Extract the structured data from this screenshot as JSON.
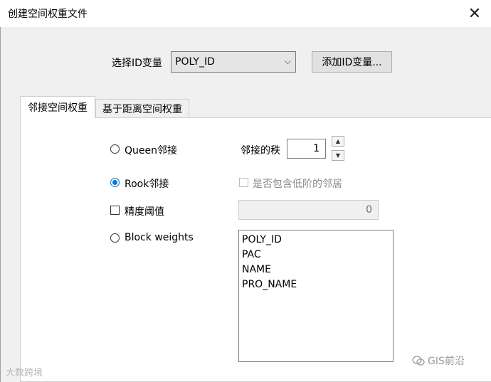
{
  "window": {
    "title": "创建空间权重文件",
    "close_glyph": "✕"
  },
  "id_select": {
    "label": "选择ID变量",
    "value": "POLY_ID",
    "chevron": "⌵"
  },
  "add_id_button": "添加ID变量...",
  "tabs": [
    {
      "label": "邻接空间权重",
      "active": true
    },
    {
      "label": "基于距离空间权重",
      "active": false
    }
  ],
  "contiguity": {
    "queen_label": "Queen邻接",
    "order_label": "邻接的秩",
    "order_value": "1",
    "spin_up": "▲",
    "spin_down": "▼",
    "rook_label": "Rook邻接",
    "rook_checked": true,
    "include_lower_label": "是否包含低阶的邻居",
    "precision_label": "精度阈值",
    "precision_value": "0",
    "block_label": "Block weights",
    "fields": [
      "POLY_ID",
      "PAC",
      "NAME",
      "PRO_NAME"
    ]
  },
  "watermarks": {
    "left": "大数跨境",
    "right": "GIS前沿"
  },
  "colors": {
    "accent": "#0078d7",
    "background": "#f0f0f0"
  }
}
